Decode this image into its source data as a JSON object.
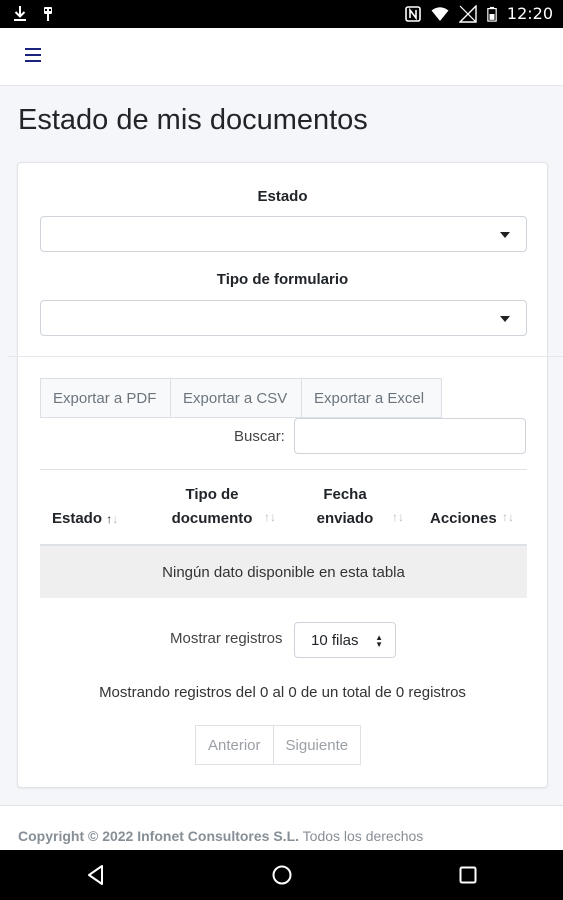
{
  "status_bar": {
    "time": "12:20",
    "icons": [
      "download-icon",
      "usb-icon",
      "nfc-icon",
      "wifi-icon",
      "signal-icon",
      "battery-icon"
    ]
  },
  "header": {
    "menu_icon": "hamburger-icon"
  },
  "page": {
    "title": "Estado de mis documentos"
  },
  "filters": {
    "estado_label": "Estado",
    "estado_value": "",
    "tipo_label": "Tipo de formulario",
    "tipo_value": ""
  },
  "export_buttons": [
    "Exportar a PDF",
    "Exportar a CSV",
    "Exportar a Excel"
  ],
  "search": {
    "label": "Buscar:",
    "value": ""
  },
  "table": {
    "columns": [
      {
        "line1": "Estado",
        "line2": ""
      },
      {
        "line1": "Tipo de",
        "line2": "documento"
      },
      {
        "line1": "Fecha",
        "line2": "enviado"
      },
      {
        "line1": "Acciones",
        "line2": ""
      }
    ],
    "empty_message": "Ningún dato disponible en esta tabla"
  },
  "length": {
    "label": "Mostrar registros",
    "value": "10 filas"
  },
  "info": "Mostrando registros del 0 al 0 de un total de 0 registros",
  "pagination": {
    "prev": "Anterior",
    "next": "Siguiente"
  },
  "footer": {
    "copyright": "Copyright © 2022 Infonet Consultores S.L.",
    "rights": "Todos los derechos"
  },
  "colors": {
    "accent": "#1a237e",
    "background": "#f4f6f9",
    "statusbar": "#000000"
  }
}
